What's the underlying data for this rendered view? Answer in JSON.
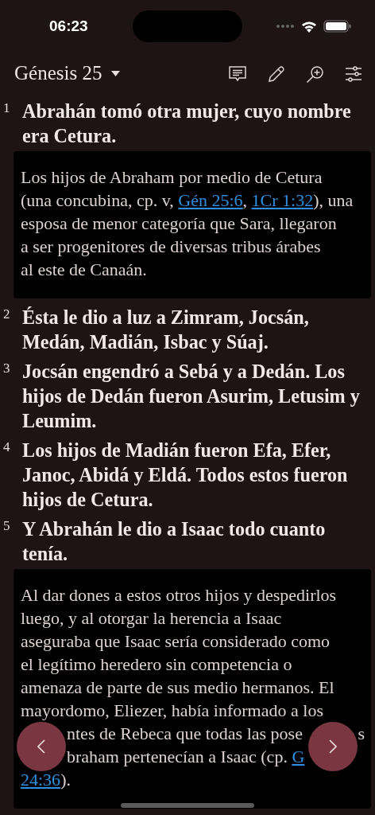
{
  "status_bar": {
    "time": "06:23"
  },
  "header": {
    "title": "Génesis 25"
  },
  "verses": [
    {
      "number": "1",
      "text": "Abrahán tomó otra mujer, cuyo nombre era Cetura.",
      "note": [
        [
          {
            "kind": "text",
            "text": "Los hijos de Abraham por medio de Cetura"
          }
        ],
        [
          {
            "kind": "text",
            "text": "(una concubina, cp. v, "
          },
          {
            "kind": "link",
            "text": "Gén 25:6"
          },
          {
            "kind": "text",
            "text": ", "
          },
          {
            "kind": "link",
            "text": "1Cr 1:32"
          },
          {
            "kind": "text",
            "text": "), una"
          }
        ],
        [
          {
            "kind": "text",
            "text": "esposa de menor categoría que Sara, llegaron"
          }
        ],
        [
          {
            "kind": "text",
            "text": "a ser progenitores de diversas tribus árabes"
          }
        ],
        [
          {
            "kind": "text",
            "text": "al este de Canaán."
          }
        ]
      ]
    },
    {
      "number": "2",
      "text": "Ésta le dio a luz a Zimram, Jocsán, Medán, Madián, Isbac y Súaj."
    },
    {
      "number": "3",
      "text": "Jocsán engendró a Sebá y a Dedán. Los hijos de Dedán fueron Asurim, Letusim y Leumim."
    },
    {
      "number": "4",
      "text": "Los hijos de Madián fueron Efa, Efer, Janoc, Abidá y Eldá. Todos estos fueron hijos de Cetura."
    },
    {
      "number": "5",
      "text": "Y Abrahán le dio a Isaac todo cuanto tenía.",
      "note": [
        [
          {
            "kind": "text",
            "text": "Al dar dones a estos otros hijos y despedirlos"
          }
        ],
        [
          {
            "kind": "text",
            "text": "luego, y al otorgar la herencia a Isaac"
          }
        ],
        [
          {
            "kind": "text",
            "text": "aseguraba que Isaac sería considerado como"
          }
        ],
        [
          {
            "kind": "text",
            "text": "el legítimo heredero sin competencia o"
          }
        ],
        [
          {
            "kind": "text",
            "text": "amenaza de parte de sus medio hermanos. El"
          }
        ],
        [
          {
            "kind": "text",
            "text": "mayordomo, Eliezer, había informado a los"
          }
        ],
        [
          {
            "kind": "gap"
          },
          {
            "kind": "text",
            "text": "ntes de Rebeca que todas las pose"
          },
          {
            "kind": "gap"
          },
          {
            "kind": "text",
            "text": "s"
          }
        ],
        [
          {
            "kind": "gap"
          },
          {
            "kind": "text",
            "text": "braham pertenecían a Isaac (cp. "
          },
          {
            "kind": "link",
            "text": "G"
          }
        ],
        [
          {
            "kind": "link",
            "text": "24:36"
          },
          {
            "kind": "text",
            "text": ")."
          }
        ]
      ]
    }
  ]
}
